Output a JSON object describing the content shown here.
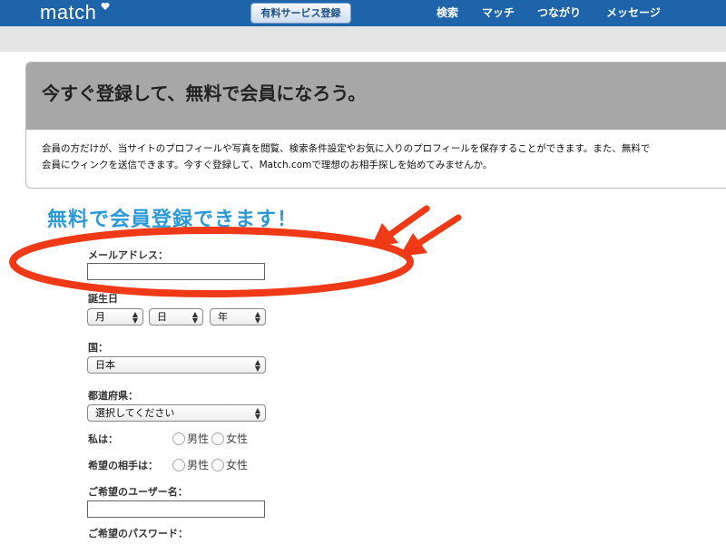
{
  "header": {
    "logo": "match",
    "upgrade_button": "有料サービス登録",
    "nav": [
      "検索",
      "マッチ",
      "つながり",
      "メッセージ"
    ]
  },
  "banner": {
    "title": "今すぐ登録して、無料で会員になろう。",
    "body_line1": "会員の方だけが、当サイトのプロフィールや写真を閲覧、検索条件設定やお気に入りのプロフィールを保存することができます。また、無料で",
    "body_line2": "会員にウィンクを送信できます。今すぐ登録して、Match.comで理想のお相手探しを始めてみませんか。"
  },
  "form": {
    "heading": "無料で会員登録できます！",
    "email_label": "メールアドレス：",
    "email_value": "",
    "birthday_label": "誕生日",
    "birthday_month": "月",
    "birthday_day": "日",
    "birthday_year": "年",
    "country_label": "国：",
    "country_value": "日本",
    "prefecture_label": "都道府県：",
    "prefecture_value": "選択してください",
    "i_am_label": "私は：",
    "seeking_label": "希望の相手は：",
    "male": "男性",
    "female": "女性",
    "username_label": "ご希望のユーザー名：",
    "username_value": "",
    "password_label": "ご希望のパスワード："
  },
  "colors": {
    "header_bg": "#1e64aa",
    "heading_blue": "#2d9ad8",
    "annotation_red": "#f03a17"
  },
  "icons": [
    "heart-icon",
    "select-arrows-icon",
    "radio-icon",
    "arrow-icon"
  ]
}
